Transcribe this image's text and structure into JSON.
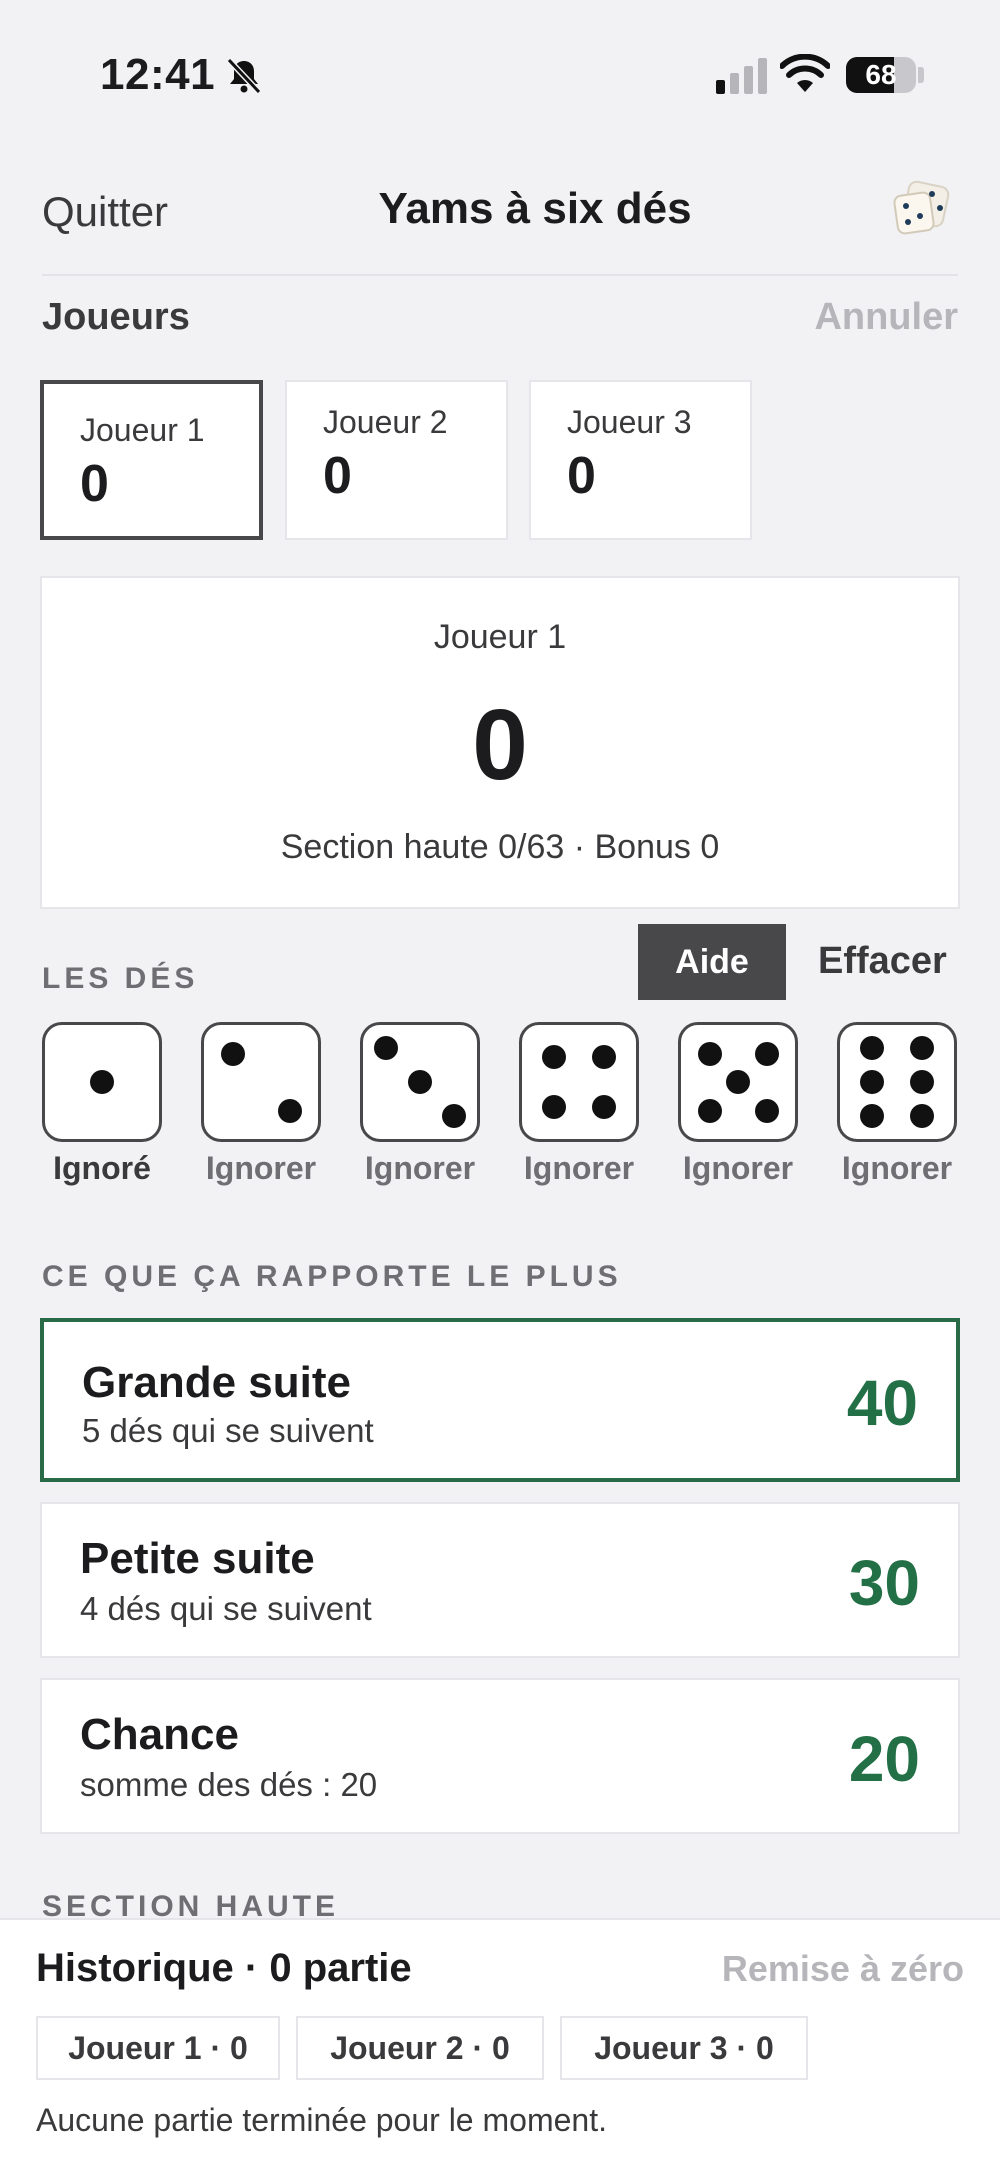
{
  "status": {
    "time": "12:41",
    "battery": "68",
    "battery_level": 0.68
  },
  "nav": {
    "quit_label": "Quitter",
    "title": "Yams à six dés"
  },
  "players_section": {
    "title": "Joueurs",
    "cancel_label": "Annuler"
  },
  "players": [
    {
      "name": "Joueur 1",
      "score": "0",
      "active": true
    },
    {
      "name": "Joueur 2",
      "score": "0",
      "active": false
    },
    {
      "name": "Joueur 3",
      "score": "0",
      "active": false
    }
  ],
  "current": {
    "name": "Joueur 1",
    "score": "0",
    "subtitle": "Section haute 0/63 · Bonus 0"
  },
  "dice_section": {
    "title": "LES DÉS",
    "help_label": "Aide",
    "clear_label": "Effacer"
  },
  "dice": [
    {
      "value": 1,
      "label": "Ignoré",
      "ignored": true
    },
    {
      "value": 2,
      "label": "Ignorer",
      "ignored": false
    },
    {
      "value": 3,
      "label": "Ignorer",
      "ignored": false
    },
    {
      "value": 4,
      "label": "Ignorer",
      "ignored": false
    },
    {
      "value": 5,
      "label": "Ignorer",
      "ignored": false
    },
    {
      "value": 6,
      "label": "Ignorer",
      "ignored": false
    }
  ],
  "suggestions_title": "CE QUE ÇA RAPPORTE LE PLUS",
  "suggestions": [
    {
      "name": "Grande suite",
      "desc": "5 dés qui se suivent",
      "points": "40",
      "best": true
    },
    {
      "name": "Petite suite",
      "desc": "4 dés qui se suivent",
      "points": "30",
      "best": false
    },
    {
      "name": "Chance",
      "desc": "somme des dés : 20",
      "points": "20",
      "best": false
    }
  ],
  "upper_section_title": "SECTION HAUTE",
  "history": {
    "title": "Historique · 0 partie",
    "reset_label": "Remise à zéro",
    "chips": [
      "Joueur 1 · 0",
      "Joueur 2 · 0",
      "Joueur 3 · 0"
    ],
    "empty_text": "Aucune partie terminée pour le moment."
  },
  "colors": {
    "accent_green": "#237047",
    "dark": "#48484a",
    "background": "#f2f2f5"
  }
}
